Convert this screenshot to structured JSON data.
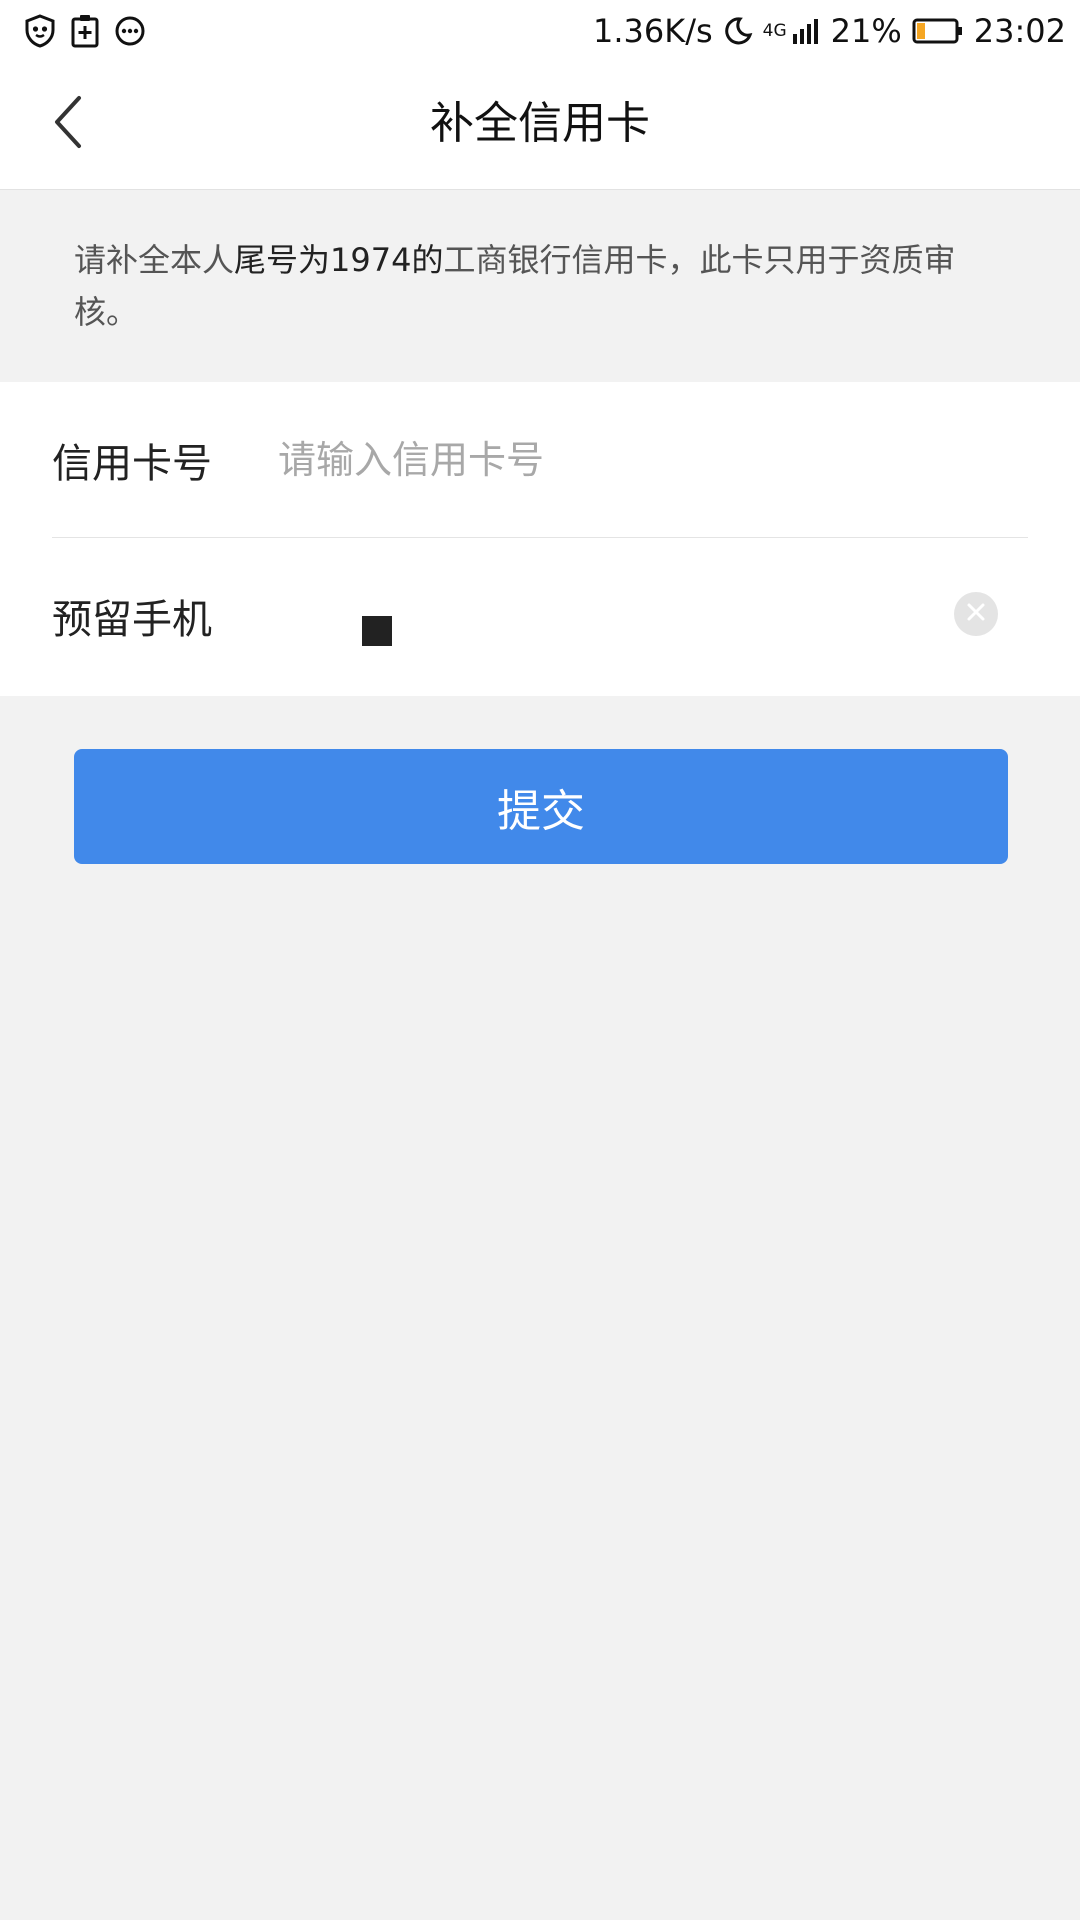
{
  "status_bar": {
    "icons_left": [
      "shield-icon",
      "clipboard-plus-icon",
      "chat-bubble-icon"
    ],
    "net_speed": "1.36K/s",
    "network": "4G",
    "battery_percent": "21%",
    "battery_level": 0.21,
    "battery_color": "#f5a623",
    "time": "23:02"
  },
  "nav": {
    "back_icon": "chevron-left-icon",
    "title": "补全信用卡"
  },
  "notice": {
    "prefix": "请补全本人",
    "highlight": "尾号为1974的",
    "suffix": "工商银行信用卡，此卡只用于资质审核。"
  },
  "form": {
    "card": {
      "label": "信用卡号",
      "placeholder": "请输入信用卡号",
      "value": ""
    },
    "phone": {
      "label": "预留手机",
      "clear_icon": "clear-icon"
    }
  },
  "submit": {
    "label": "提交",
    "color": "#4189ea"
  }
}
